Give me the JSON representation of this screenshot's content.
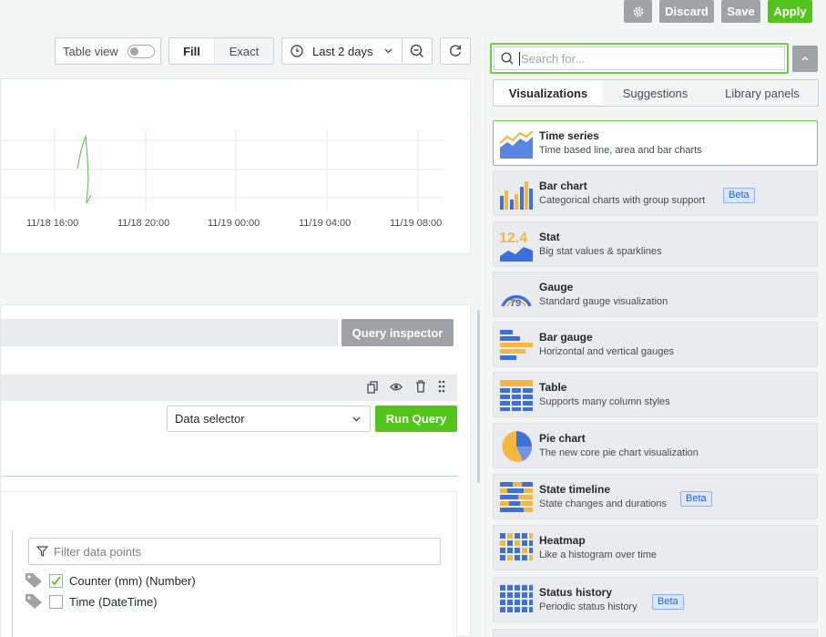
{
  "header": {
    "discard_label": "Discard",
    "save_label": "Save",
    "apply_label": "Apply"
  },
  "toolbar": {
    "table_view_label": "Table view",
    "fill_label": "Fill",
    "exact_label": "Exact",
    "time_range_label": "Last 2 days"
  },
  "graph": {
    "x_ticks": [
      "11/18 16:00",
      "11/18 20:00",
      "11/19 00:00",
      "11/19 04:00",
      "11/19 08:00"
    ]
  },
  "query": {
    "inspector_label": "Query inspector",
    "data_selector_value": "Data selector",
    "run_query_label": "Run Query"
  },
  "transform": {
    "filter_placeholder": "Filter data points",
    "fields": [
      {
        "label": "Counter (mm) (Number)",
        "checked": true
      },
      {
        "label": "Time (DateTime)",
        "checked": false
      }
    ]
  },
  "picker": {
    "search_placeholder": "Search for...",
    "tabs": [
      "Visualizations",
      "Suggestions",
      "Library panels"
    ],
    "items": [
      {
        "title": "Time series",
        "desc": "Time based line, area and bar charts",
        "beta": "",
        "icon": "time-series-icon"
      },
      {
        "title": "Bar chart",
        "desc": "Categorical charts with group support",
        "beta": "Beta",
        "icon": "bar-chart-icon"
      },
      {
        "title": "Stat",
        "desc": "Big stat values & sparklines",
        "beta": "",
        "icon": "stat-icon",
        "icon_text": "12.4"
      },
      {
        "title": "Gauge",
        "desc": "Standard gauge visualization",
        "beta": "",
        "icon": "gauge-icon",
        "icon_text": "79"
      },
      {
        "title": "Bar gauge",
        "desc": "Horizontal and vertical gauges",
        "beta": "",
        "icon": "bar-gauge-icon"
      },
      {
        "title": "Table",
        "desc": "Supports many column styles",
        "beta": "",
        "icon": "table-icon"
      },
      {
        "title": "Pie chart",
        "desc": "The new core pie chart visualization",
        "beta": "",
        "icon": "pie-chart-icon"
      },
      {
        "title": "State timeline",
        "desc": "State changes and durations",
        "beta": "Beta",
        "icon": "state-timeline-icon"
      },
      {
        "title": "Heatmap",
        "desc": "Like a histogram over time",
        "beta": "",
        "icon": "heatmap-icon"
      },
      {
        "title": "Status history",
        "desc": "Periodic status history",
        "beta": "Beta",
        "icon": "status-history-icon"
      }
    ]
  },
  "colors": {
    "accent_green": "#52c41a",
    "brand_blue": "#3d71d9",
    "brand_orange": "#f5b73d"
  }
}
